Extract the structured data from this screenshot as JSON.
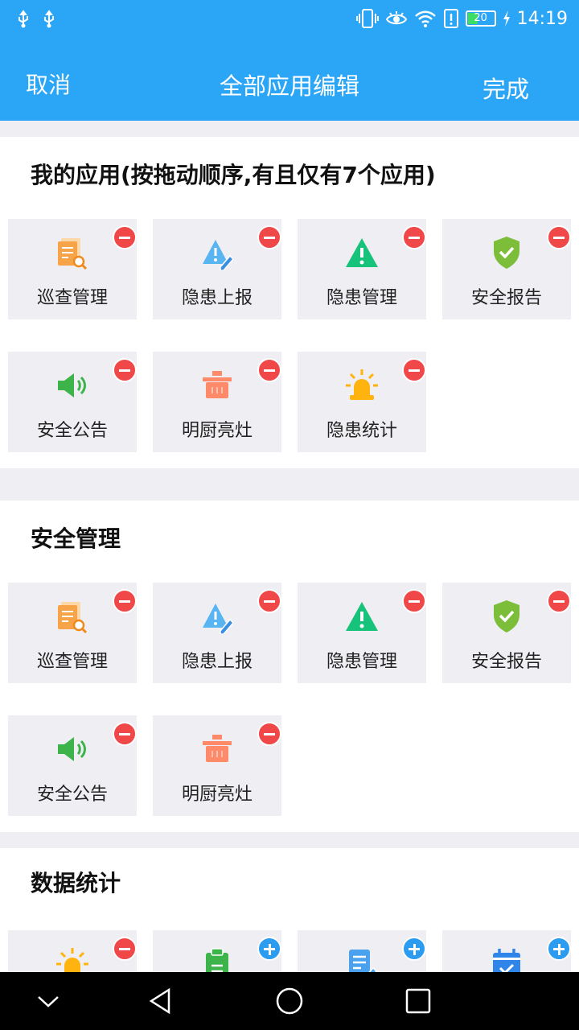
{
  "status_bar": {
    "time": "14:19",
    "battery": "20",
    "icons": [
      "usb-icon",
      "usb-icon",
      "vibrate-icon",
      "eye-icon",
      "wifi-icon",
      "alert-icon",
      "battery-icon",
      "charging-icon"
    ]
  },
  "header": {
    "cancel": "取消",
    "title": "全部应用编辑",
    "done": "完成"
  },
  "colors": {
    "primary": "#2ba6f7",
    "remove": "#f04848",
    "add": "#2b9cf0",
    "tile_bg": "#efeff3"
  },
  "sections": [
    {
      "title": "我的应用(按拖动顺序,有且仅有7个应用)",
      "items": [
        {
          "label": "巡查管理",
          "icon": "document-search-icon",
          "action": "remove"
        },
        {
          "label": "隐患上报",
          "icon": "warning-edit-icon",
          "action": "remove"
        },
        {
          "label": "隐患管理",
          "icon": "warning-icon",
          "action": "remove"
        },
        {
          "label": "安全报告",
          "icon": "shield-check-icon",
          "action": "remove"
        },
        {
          "label": "安全公告",
          "icon": "speaker-icon",
          "action": "remove"
        },
        {
          "label": "明厨亮灶",
          "icon": "pot-icon",
          "action": "remove"
        },
        {
          "label": "隐患统计",
          "icon": "alarm-light-icon",
          "action": "remove"
        }
      ]
    },
    {
      "title": "安全管理",
      "items": [
        {
          "label": "巡查管理",
          "icon": "document-search-icon",
          "action": "remove"
        },
        {
          "label": "隐患上报",
          "icon": "warning-edit-icon",
          "action": "remove"
        },
        {
          "label": "隐患管理",
          "icon": "warning-icon",
          "action": "remove"
        },
        {
          "label": "安全报告",
          "icon": "shield-check-icon",
          "action": "remove"
        },
        {
          "label": "安全公告",
          "icon": "speaker-icon",
          "action": "remove"
        },
        {
          "label": "明厨亮灶",
          "icon": "pot-icon",
          "action": "remove"
        }
      ]
    },
    {
      "title": "数据统计",
      "items": [
        {
          "label": "",
          "icon": "alarm-light-icon",
          "action": "remove"
        },
        {
          "label": "",
          "icon": "clipboard-icon",
          "action": "add"
        },
        {
          "label": "",
          "icon": "document-edit-icon",
          "action": "add"
        },
        {
          "label": "",
          "icon": "calendar-check-icon",
          "action": "add"
        }
      ]
    }
  ],
  "nav_bar": {
    "buttons": [
      "collapse-icon",
      "back-icon",
      "home-icon",
      "recents-icon"
    ]
  }
}
